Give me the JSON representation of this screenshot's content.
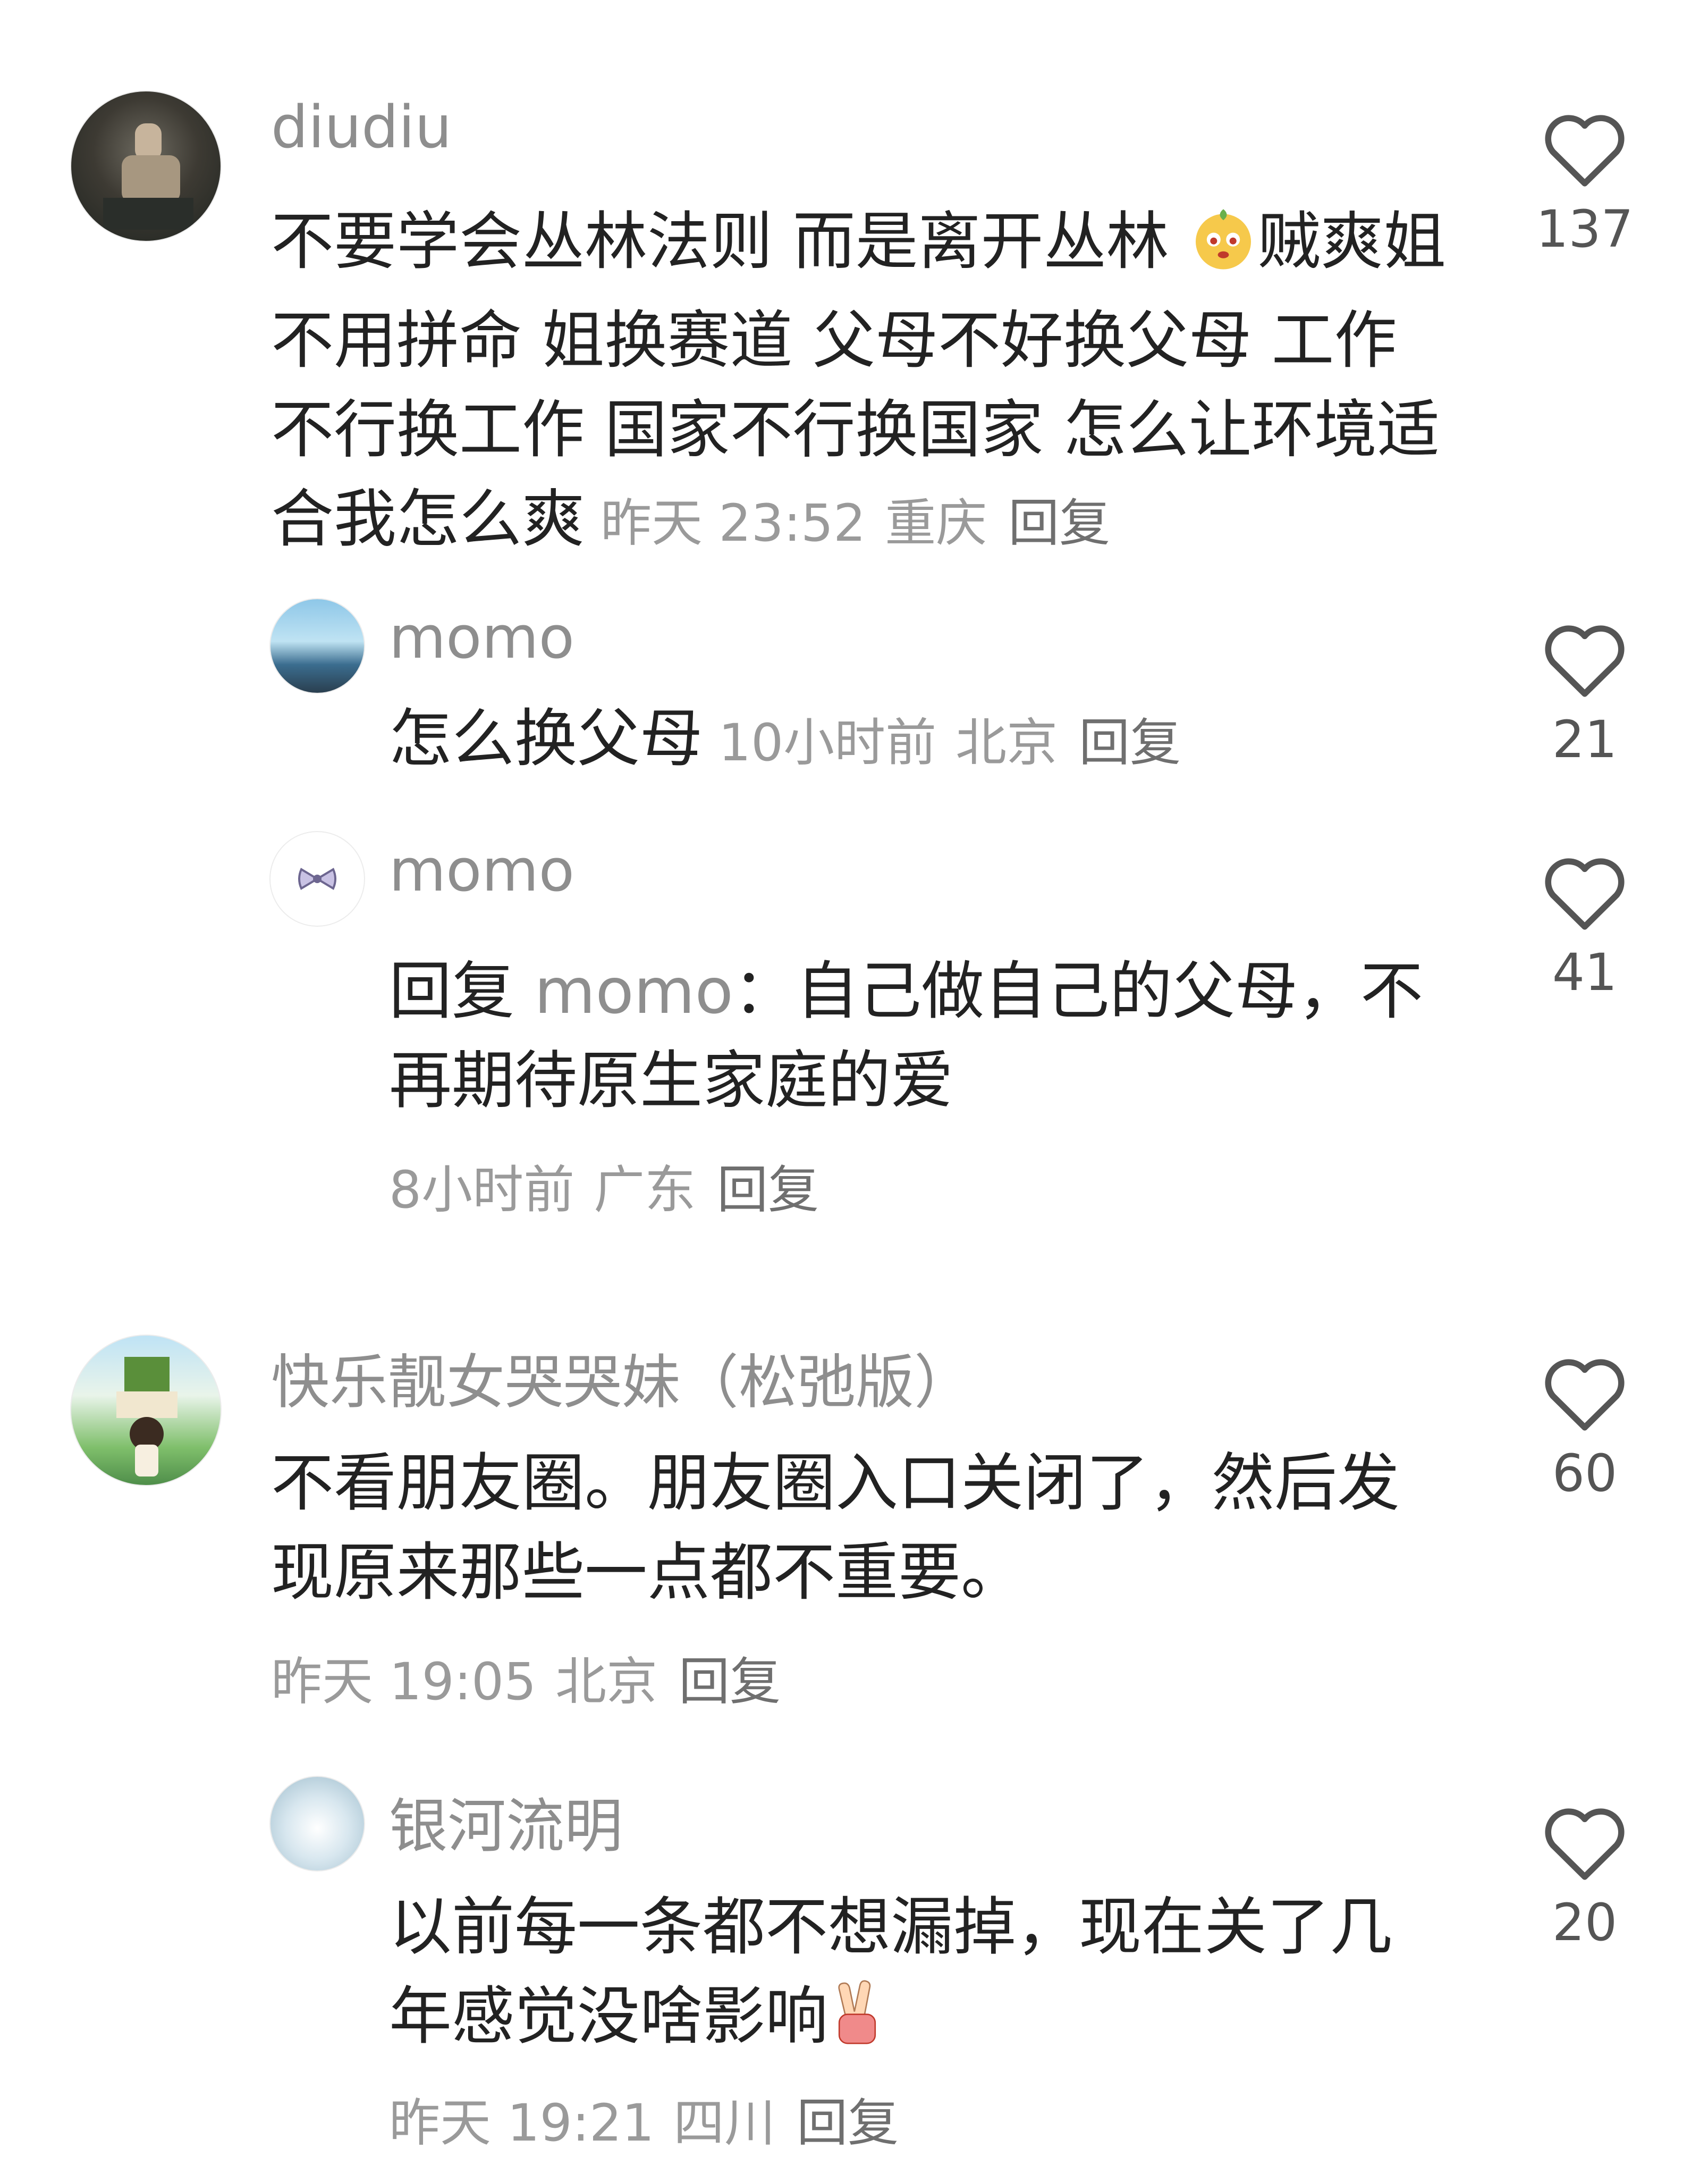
{
  "comments": [
    {
      "username": "diudiu",
      "text_a": "不要学会丛林法则 而是离开丛林 ",
      "text_b": "贼爽姐不用拼命 姐换赛道 父母不好换父母 工作不行换工作 国家不行换国家 怎么让环境适合我怎么爽",
      "time": "昨天 23:52",
      "location": "重庆",
      "reply_label": "回复",
      "likes": "137"
    },
    {
      "username": "momo",
      "text": "怎么换父母",
      "time": "10小时前",
      "location": "北京",
      "reply_label": "回复",
      "likes": "21"
    },
    {
      "username": "momo",
      "reply_prefix": "回复",
      "mention": "momo",
      "text": "：自己做自己的父母，不再期待原生家庭的爱",
      "time": "8小时前",
      "location": "广东",
      "reply_label": "回复",
      "likes": "41"
    },
    {
      "username": "快乐靓女哭哭妹（松弛版）",
      "text": "不看朋友圈。朋友圈入口关闭了，然后发现原来那些一点都不重要。",
      "time": "昨天 19:05",
      "location": "北京",
      "reply_label": "回复",
      "likes": "60"
    },
    {
      "username": "银河流明",
      "text": "以前每一条都不想漏掉，现在关了几年感觉没啥影响",
      "time": "昨天 19:21",
      "location": "四川",
      "reply_label": "回复",
      "likes": "20"
    }
  ],
  "icons": {
    "like": "heart-outline-icon",
    "emoji_1": "cartoon-face-emoji",
    "emoji_2": "victory-hand-emoji"
  },
  "colors": {
    "username": "#8e8e8e",
    "body_text": "#222222",
    "meta_text": "#9a9a9a"
  }
}
